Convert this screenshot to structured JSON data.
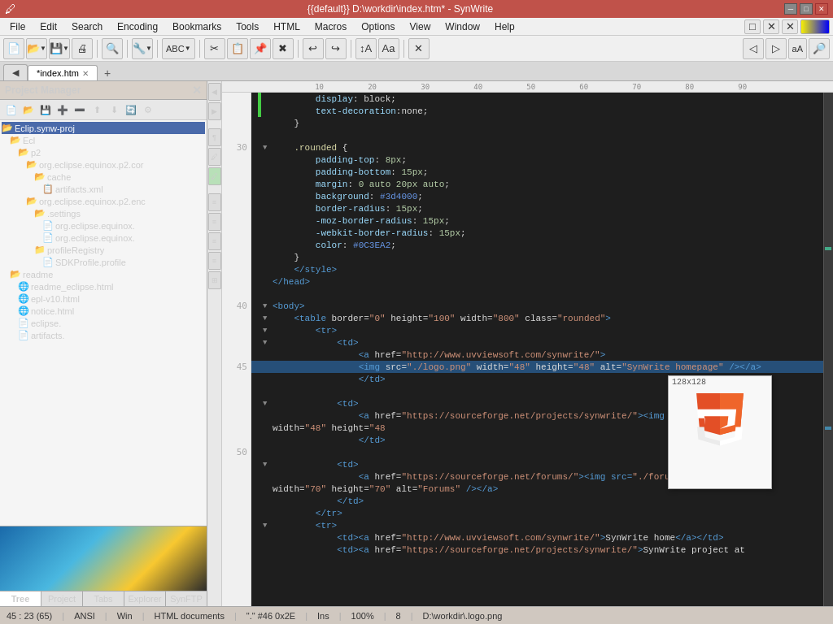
{
  "titlebar": {
    "title": "{{default}} D:\\workdir\\index.htm* - SynWrite",
    "min_btn": "─",
    "max_btn": "□",
    "close_btn": "✕"
  },
  "menubar": {
    "items": [
      "File",
      "Edit",
      "Search",
      "Encoding",
      "Bookmarks",
      "Tools",
      "HTML",
      "Macros",
      "Options",
      "View",
      "Window",
      "Help"
    ]
  },
  "tabs": {
    "items": [
      {
        "label": "*index.htm",
        "active": true
      },
      {
        "label": "+",
        "is_new": true
      }
    ]
  },
  "project_manager": {
    "title": "Project Manager",
    "tree": [
      {
        "indent": 0,
        "type": "folder",
        "open": true,
        "label": "Eclip.synw-proj"
      },
      {
        "indent": 1,
        "type": "folder",
        "open": true,
        "label": "Ecl"
      },
      {
        "indent": 2,
        "type": "folder",
        "open": true,
        "label": "p2"
      },
      {
        "indent": 3,
        "type": "folder",
        "open": true,
        "label": "org.eclipse.equinox.p2.cor"
      },
      {
        "indent": 4,
        "type": "folder",
        "open": true,
        "label": "cache"
      },
      {
        "indent": 5,
        "type": "file",
        "label": "artifacts.xml"
      },
      {
        "indent": 3,
        "type": "folder",
        "open": true,
        "label": "org.eclipse.equinox.p2.enc"
      },
      {
        "indent": 4,
        "type": "folder",
        "open": true,
        "label": ".settings"
      },
      {
        "indent": 5,
        "type": "file",
        "label": "org.eclipse.equinox."
      },
      {
        "indent": 5,
        "type": "file",
        "label": "org.eclipse.equinox."
      },
      {
        "indent": 4,
        "type": "folder",
        "open": false,
        "label": "profileRegistry"
      },
      {
        "indent": 5,
        "type": "file",
        "label": "SDKProfile.profile"
      },
      {
        "indent": 1,
        "type": "folder",
        "open": true,
        "label": "readme"
      },
      {
        "indent": 2,
        "type": "file",
        "label": "readme_eclipse.html"
      },
      {
        "indent": 2,
        "type": "file",
        "label": "epl-v10.html"
      },
      {
        "indent": 2,
        "type": "file",
        "label": "notice.html"
      },
      {
        "indent": 2,
        "type": "file",
        "label": "eclipse."
      },
      {
        "indent": 2,
        "type": "file",
        "label": "artifacts."
      }
    ]
  },
  "bottom_tabs": [
    "Tree",
    "Project",
    "Tabs",
    "Explorer",
    "SynFTP"
  ],
  "code_lines": [
    {
      "num": "",
      "text": "        display: block;",
      "indent": 8,
      "fold": ""
    },
    {
      "num": "",
      "text": "        text-decoration:none;",
      "indent": 8,
      "fold": ""
    },
    {
      "num": "",
      "text": "    }",
      "indent": 4,
      "fold": ""
    },
    {
      "num": "",
      "text": "",
      "indent": 0,
      "fold": ""
    },
    {
      "num": "",
      "text": "    .rounded {",
      "indent": 4,
      "fold": "▼"
    },
    {
      "num": "",
      "text": "        padding-top: 8px;",
      "indent": 8,
      "fold": ""
    },
    {
      "num": "",
      "text": "        padding-bottom: 15px;",
      "indent": 8,
      "fold": ""
    },
    {
      "num": "",
      "text": "        margin: 0 auto 20px auto;",
      "indent": 8,
      "fold": ""
    },
    {
      "num": "",
      "text": "        background: #3d4000;",
      "indent": 8,
      "fold": ""
    },
    {
      "num": "",
      "text": "        border-radius: 15px;",
      "indent": 8,
      "fold": ""
    },
    {
      "num": "",
      "text": "        -moz-border-radius: 15px;",
      "indent": 8,
      "fold": ""
    },
    {
      "num": "",
      "text": "        -webkit-border-radius: 15px;",
      "indent": 8,
      "fold": ""
    },
    {
      "num": "",
      "text": "        color: #0C3EA2;",
      "indent": 8,
      "fold": ""
    },
    {
      "num": "",
      "text": "    }",
      "indent": 4,
      "fold": ""
    },
    {
      "num": "",
      "text": "    </style>",
      "indent": 4,
      "fold": ""
    },
    {
      "num": "",
      "text": "</head>",
      "indent": 0,
      "fold": ""
    },
    {
      "num": "",
      "text": "",
      "indent": 0,
      "fold": ""
    },
    {
      "num": "",
      "text": "<body>",
      "indent": 0,
      "fold": "▼"
    },
    {
      "num": "",
      "text": "    <table border=\"0\" height=\"100\" width=\"800\" class=\"rounded\">",
      "indent": 4,
      "fold": "▼"
    },
    {
      "num": "",
      "text": "        <tr>",
      "indent": 8,
      "fold": "▼"
    },
    {
      "num": "",
      "text": "            <td>",
      "indent": 12,
      "fold": "▼"
    },
    {
      "num": "",
      "text": "                <a href=\"http://www.uvviewsoft.com/synwrite/\">",
      "indent": 16,
      "fold": ""
    },
    {
      "num": "45",
      "text": "                <img src=\"./logo.png\" width=\"48\" height=\"48\" alt=\"SynWrite homepage\" /></a>",
      "indent": 16,
      "fold": "",
      "highlight": true
    },
    {
      "num": "",
      "text": "                </td>",
      "indent": 16,
      "fold": ""
    },
    {
      "num": "",
      "text": "",
      "indent": 0,
      "fold": ""
    },
    {
      "num": "",
      "text": "            <td>",
      "indent": 12,
      "fold": "▼"
    },
    {
      "num": "",
      "text": "                <a href=\"https://sourceforge.net/projects/synwrite/\"><img src=\"./sf.png\"",
      "indent": 16,
      "fold": ""
    },
    {
      "num": "",
      "text": "width=\"48\" height=\"48",
      "indent": 16,
      "fold": ""
    },
    {
      "num": "",
      "text": "                </td>",
      "indent": 16,
      "fold": ""
    },
    {
      "num": "50",
      "text": "",
      "indent": 0,
      "fold": ""
    },
    {
      "num": "",
      "text": "            <td>",
      "indent": 12,
      "fold": "▼"
    },
    {
      "num": "",
      "text": "                <a href=\"https://sourceforge.net/forums/\"><img src=\"./forum.png\"",
      "indent": 16,
      "fold": ""
    },
    {
      "num": "",
      "text": "width=\"70\" height=\"70\" alt=\"Forums\" /></a>",
      "indent": 16,
      "fold": ""
    },
    {
      "num": "",
      "text": "            </td>",
      "indent": 12,
      "fold": ""
    },
    {
      "num": "",
      "text": "        </tr>",
      "indent": 8,
      "fold": ""
    },
    {
      "num": "",
      "text": "        <tr>",
      "indent": 8,
      "fold": "▼"
    },
    {
      "num": "",
      "text": "            <td><a href=\"http://www.uvviewsoft.com/synwrite/\">SynWrite home</a></td>",
      "indent": 12,
      "fold": ""
    },
    {
      "num": "",
      "text": "            <td><a href=\"https://sourceforge.net/projects/synwrite/\">SynWrite project at",
      "indent": 12,
      "fold": ""
    }
  ],
  "statusbar": {
    "position": "45 : 23 (65)",
    "encoding": "ANSI",
    "eol": "Win",
    "syntax": "HTML documents",
    "cursor_char": "\".\" #46 0x2E",
    "ins_mode": "Ins",
    "zoom": "100%",
    "col": "8",
    "file": "D:\\workdir\\.logo.png"
  },
  "preview": {
    "size_label": "128x128",
    "path": "D:\\workdir\\.logo.png"
  }
}
